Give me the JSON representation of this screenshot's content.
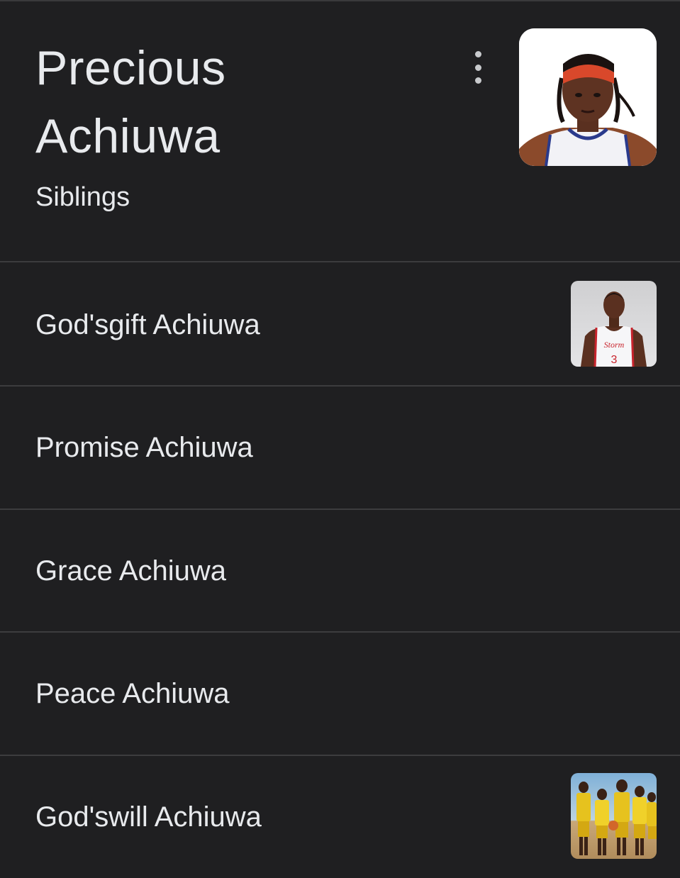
{
  "header": {
    "title_line1": "Precious",
    "title_line2": "Achiuwa",
    "subtitle": "Siblings",
    "more_icon": "more-vertical-icon"
  },
  "siblings": [
    {
      "name": "God'sgift Achiuwa",
      "has_photo": true
    },
    {
      "name": "Promise Achiuwa",
      "has_photo": false
    },
    {
      "name": "Grace Achiuwa",
      "has_photo": false
    },
    {
      "name": "Peace Achiuwa",
      "has_photo": false
    },
    {
      "name": "God'swill Achiuwa",
      "has_photo": true
    }
  ],
  "colors": {
    "background": "#1f1f21",
    "text": "#e8eaed",
    "divider": "#3c3c3e"
  }
}
